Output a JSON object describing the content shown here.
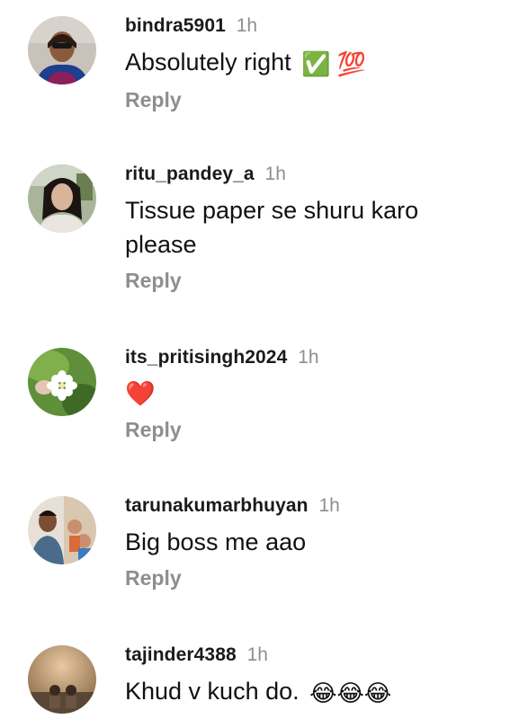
{
  "comments": [
    {
      "username": "bindra5901",
      "time": "1h",
      "text": "Absolutely right",
      "emojis": "✅ 💯",
      "reply_label": "Reply"
    },
    {
      "username": "ritu_pandey_a",
      "time": "1h",
      "text": "Tissue paper se shuru karo please",
      "reply_label": "Reply"
    },
    {
      "username": "its_pritisingh2024",
      "time": "1h",
      "text": "❤️",
      "reply_label": "Reply"
    },
    {
      "username": "tarunakumarbhuyan",
      "time": "1h",
      "text": "Big boss me aao",
      "reply_label": "Reply"
    },
    {
      "username": "tajinder4388",
      "time": "1h",
      "text": "Khud v kuch do.",
      "emojis": "😂😂😂"
    }
  ],
  "colors": {
    "username": "#1a1a1a",
    "meta_gray": "#8e8e8e",
    "background": "#ffffff"
  }
}
